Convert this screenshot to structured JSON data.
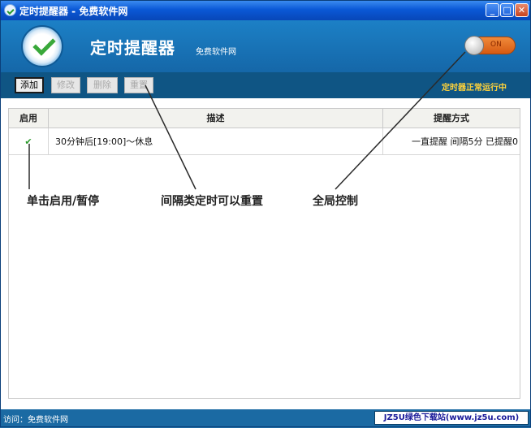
{
  "window": {
    "title": "定时提醒器 - 免费软件网"
  },
  "header": {
    "app_title": "定时提醒器",
    "app_subtitle": "免费软件网",
    "toggle_text": "ON"
  },
  "toolbar": {
    "add_label": "添加",
    "edit_label": "修改",
    "delete_label": "删除",
    "reset_label": "重置",
    "status": "定时器正常运行中"
  },
  "table": {
    "headers": {
      "enabled": "启用",
      "description": "描述",
      "mode": "提醒方式"
    },
    "rows": [
      {
        "enabled": "✔",
        "description": "30分钟后[19:00]～休息",
        "mode": "一直提醒  间隔5分  已提醒0"
      }
    ]
  },
  "annotations": {
    "toggle_note": "单击启用/暂停",
    "reset_note": "间隔类定时可以重置",
    "global_note": "全局控制"
  },
  "statusbar": {
    "text": "访问：免费软件网",
    "watermark": "JZ5U绿色下载站(www.jz5u.com)"
  },
  "colors": {
    "header": "#1c80c6",
    "toolbar": "#0f5584",
    "status_text": "#ffd23a",
    "check": "#2b9a2b",
    "toggle": "#e8741f"
  }
}
